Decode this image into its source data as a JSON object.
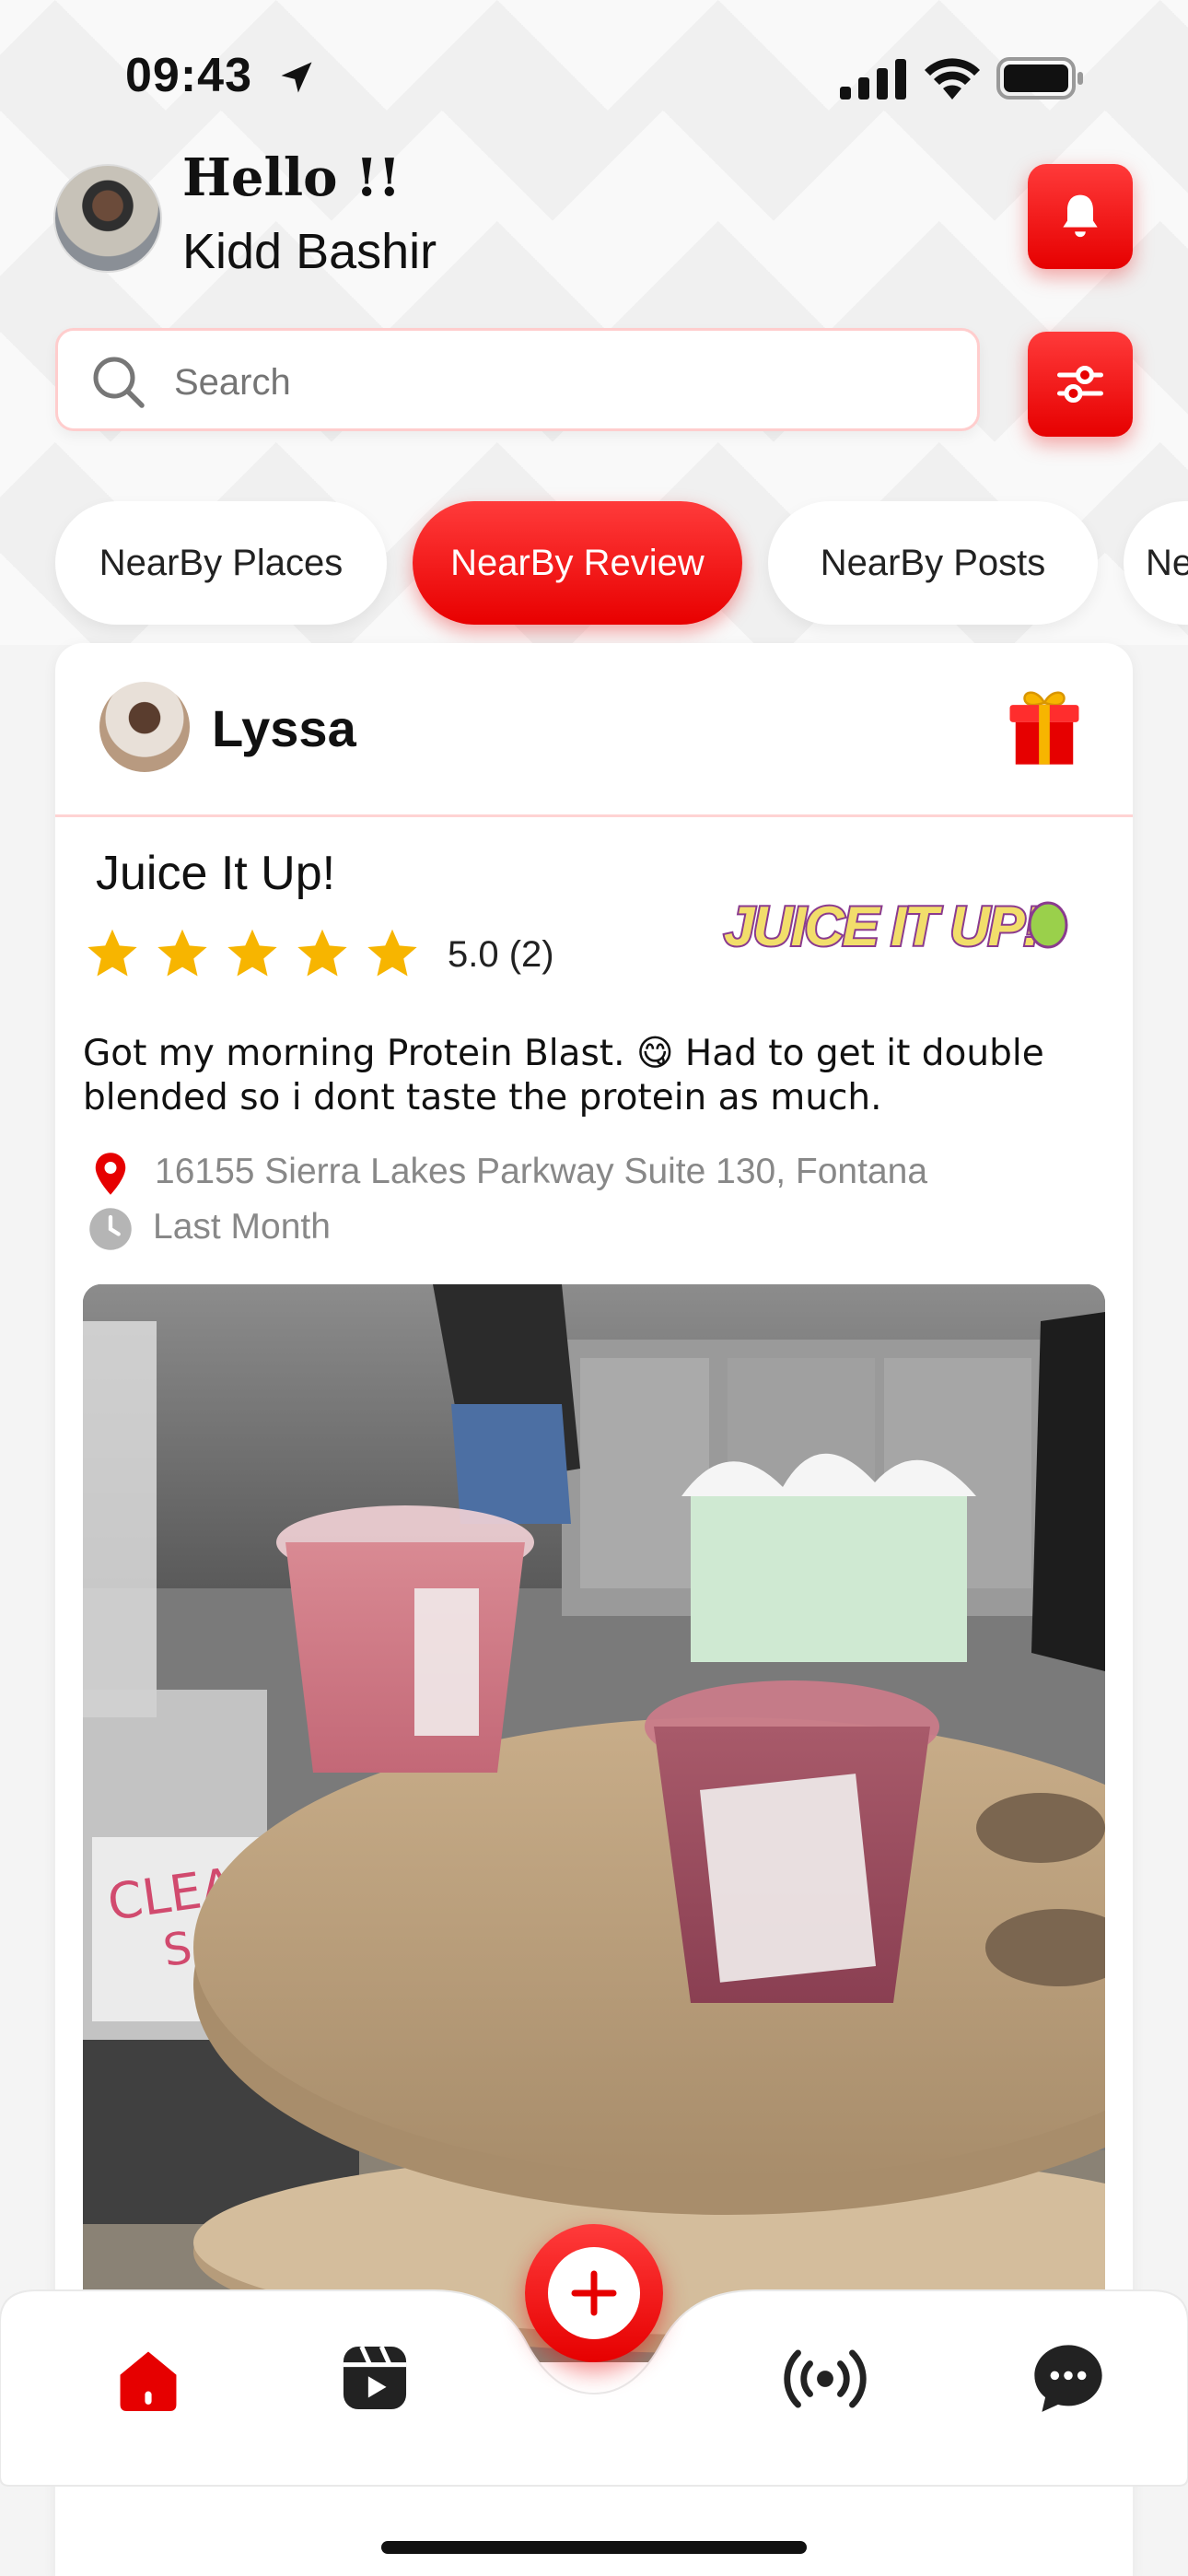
{
  "status_bar": {
    "time": "09:43"
  },
  "header": {
    "greeting": "Hello !!",
    "user_name": "Kidd Bashir"
  },
  "search": {
    "placeholder": "Search"
  },
  "tabs": [
    {
      "label": "NearBy Places",
      "active": false
    },
    {
      "label": "NearBy Review",
      "active": true
    },
    {
      "label": "NearBy Posts",
      "active": false
    },
    {
      "label": "Ne",
      "active": false
    }
  ],
  "review": {
    "reviewer_name": "Lyssa",
    "place_name": "Juice It Up!",
    "stars": 5,
    "rating_text": "5.0 (2)",
    "logo_text": "JUICE IT UP!",
    "text": "Got my morning Protein Blast. 😋 Had to get it double blended so i dont taste the protein as much.",
    "address": "16155 Sierra Lakes Parkway Suite 130, Fontana",
    "time_ago": "Last Month",
    "photo_label_1": "CLEAN",
    "photo_label_2": "Spo"
  },
  "bottom_nav": [
    {
      "name": "home",
      "icon": "home-icon"
    },
    {
      "name": "reels",
      "icon": "reels-icon"
    },
    {
      "name": "create",
      "icon": "plus-icon"
    },
    {
      "name": "live",
      "icon": "broadcast-icon"
    },
    {
      "name": "chat",
      "icon": "chat-icon"
    }
  ],
  "colors": {
    "accent": "#E60000",
    "accent_light": "#FF3A3A",
    "star": "#F7B500"
  }
}
